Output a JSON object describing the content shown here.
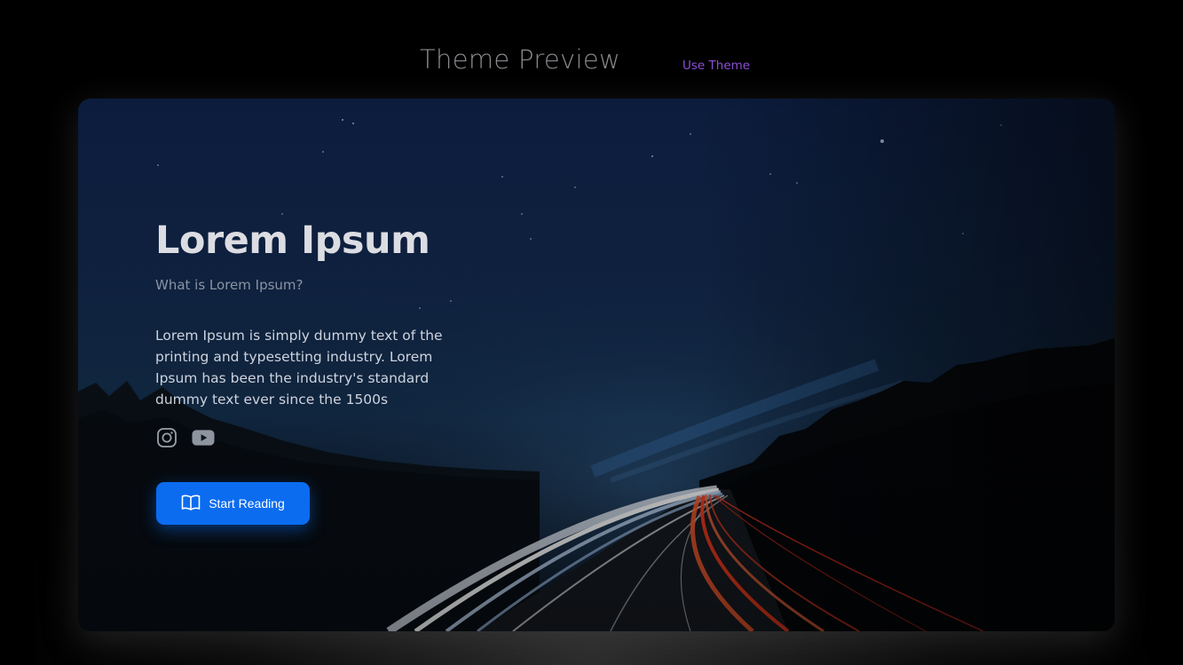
{
  "header": {
    "title": "Theme Preview",
    "use_theme_label": "Use Theme"
  },
  "hero": {
    "title": "Lorem Ipsum",
    "subtitle": "What is Lorem Ipsum?",
    "body": "Lorem Ipsum is simply dummy text of the printing and typesetting industry. Lorem Ipsum has been the industry's standard dummy text ever since the 1500s",
    "social": [
      {
        "icon": "instagram-icon"
      },
      {
        "icon": "youtube-icon"
      }
    ],
    "cta": {
      "label": "Start Reading",
      "icon": "open-book-icon"
    }
  },
  "colors": {
    "background": "#000000",
    "accent_link": "#8d4fd6",
    "button": "#0b6cf0",
    "title_text": "#dcdde3"
  }
}
